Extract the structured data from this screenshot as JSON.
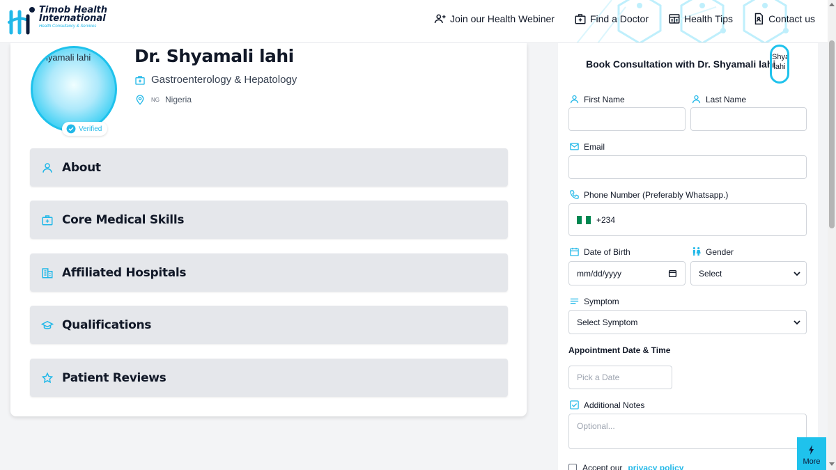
{
  "brand": {
    "name_line1": "Timob Health",
    "name_line2": "International",
    "tagline": "Health Consultancy & Services"
  },
  "nav": [
    {
      "label": "Join our Health Webiner",
      "icon": "users-icon"
    },
    {
      "label": "Find a Doctor",
      "icon": "medical-case-icon"
    },
    {
      "label": "Health Tips",
      "icon": "newspaper-icon"
    },
    {
      "label": "Contact us",
      "icon": "contact-document-icon"
    }
  ],
  "doctor": {
    "avatar_alt": "Shyamali lahi",
    "name": "Dr. Shyamali lahi",
    "specialty": "Gastroenterology & Hepatology",
    "country_code": "NG",
    "country": "Nigeria",
    "verified_label": "Verified"
  },
  "sections": [
    {
      "label": "About",
      "icon": "user-icon"
    },
    {
      "label": "Core Medical Skills",
      "icon": "medical-case-icon"
    },
    {
      "label": "Affiliated Hospitals",
      "icon": "hospital-building-icon"
    },
    {
      "label": "Qualifications",
      "icon": "graduation-cap-icon"
    },
    {
      "label": "Patient Reviews",
      "icon": "star-icon"
    }
  ],
  "form": {
    "title": "Book Consultation with Dr. Shyamali lahi",
    "avatar_alt": "Shyamali lahi",
    "first_name_label": "First Name",
    "last_name_label": "Last Name",
    "email_label": "Email",
    "phone_label": "Phone Number (Preferably Whatsapp.)",
    "phone_code": "+234",
    "dob_label": "Date of Birth",
    "dob_placeholder": "mm/dd/yyyy",
    "gender_label": "Gender",
    "gender_value": "Select",
    "symptom_label": "Symptom",
    "symptom_value": "Select Symptom",
    "appointment_label": "Appointment Date & Time",
    "date_placeholder": "Pick a Date",
    "notes_label": "Additional Notes",
    "notes_placeholder": "Optional...",
    "accept_prefix": "Accept our",
    "privacy_link": "privacy policy"
  },
  "more_button": "More",
  "colors": {
    "accent": "#1fc2ec",
    "flag_green": "#008751"
  }
}
